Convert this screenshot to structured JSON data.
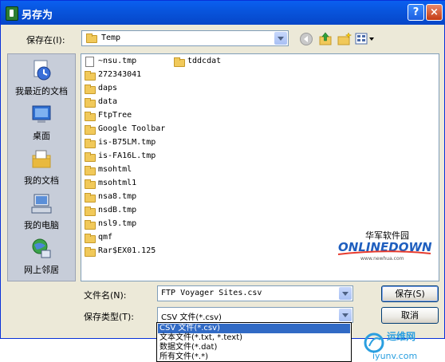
{
  "window": {
    "title": "另存为",
    "help_glyph": "?",
    "close_glyph": "×"
  },
  "save_in": {
    "label": "保存在(I):",
    "value": "Temp"
  },
  "places": [
    {
      "label": "我最近的文档",
      "icon": "recent-documents-icon",
      "color": "#3a6fd8"
    },
    {
      "label": "桌面",
      "icon": "desktop-icon",
      "color": "#2f6fd1"
    },
    {
      "label": "我的文档",
      "icon": "my-documents-icon",
      "color": "#e8c25a"
    },
    {
      "label": "我的电脑",
      "icon": "my-computer-icon",
      "color": "#6a8fc8"
    },
    {
      "label": "网上邻居",
      "icon": "network-places-icon",
      "color": "#3aa34a"
    }
  ],
  "files": [
    {
      "name": "~nsu.tmp",
      "type": "folder"
    },
    {
      "name": "272343041",
      "type": "folder"
    },
    {
      "name": "daps",
      "type": "folder"
    },
    {
      "name": "data",
      "type": "folder"
    },
    {
      "name": "FtpTree",
      "type": "folder"
    },
    {
      "name": "Google Toolbar",
      "type": "folder"
    },
    {
      "name": "is-B75LM.tmp",
      "type": "folder"
    },
    {
      "name": "is-FA16L.tmp",
      "type": "folder"
    },
    {
      "name": "msohtml",
      "type": "folder"
    },
    {
      "name": "msohtml1",
      "type": "folder"
    },
    {
      "name": "nsa8.tmp",
      "type": "folder"
    },
    {
      "name": "nsdB.tmp",
      "type": "folder"
    },
    {
      "name": "nsl9.tmp",
      "type": "folder"
    },
    {
      "name": "qmf",
      "type": "folder"
    },
    {
      "name": "Rar$EX01.125",
      "type": "folder"
    },
    {
      "name": "tddcdat",
      "type": "folder"
    }
  ],
  "filename": {
    "label": "文件名(N):",
    "value": "FTP Voyager Sites.csv"
  },
  "filetype": {
    "label": "保存类型(T):",
    "value": "CSV 文件(*.csv)",
    "options": [
      "CSV 文件(*.csv)",
      "文本文件(*.txt, *.text)",
      "数据文件(*.dat)",
      "所有文件(*.*)"
    ]
  },
  "buttons": {
    "save": "保存(S)",
    "cancel": "取消"
  },
  "logo": {
    "chinese": "华军软件园",
    "brand": "ONLINEDOWN",
    "url": "www.newhua.com"
  },
  "watermark": {
    "chinese": "运维网",
    "domain": "iyunv.com"
  }
}
